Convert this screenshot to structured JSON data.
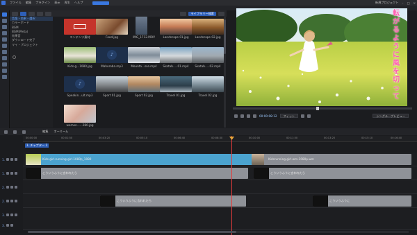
{
  "menu": {
    "items": [
      "ファイル",
      "編集",
      "プラグイン",
      "表示",
      "再生",
      "ヘルプ"
    ],
    "accent": "#3a6fd8"
  },
  "window": {
    "right_text": "新規プロジェクト"
  },
  "library": {
    "categories": [
      "音楽・効果・選択",
      "カラーボード",
      "BGM",
      "BGM(Meta)",
      "効果音",
      "ダウンロード完了",
      "マイ・プロジェクト"
    ],
    "selected_category": 0,
    "tooltip_tab": "ライブラリー検索",
    "items": [
      {
        "label": "コンテンツ素材"
      },
      {
        "label": "Food.jpg"
      },
      {
        "label": "IMG_1712.MOV"
      },
      {
        "label": "Landscape 01.jpg"
      },
      {
        "label": "Landscape 02.jpg"
      },
      {
        "label": "Kids-g...1080.jpg"
      },
      {
        "label": "Mahoroba.mp3"
      },
      {
        "label": "Mounta...sse.mp4"
      },
      {
        "label": "Skatab.....01.mp4"
      },
      {
        "label": "Skatab.....02.mp4"
      },
      {
        "label": "Speakin...ult.mp3"
      },
      {
        "label": "Sport 01.jpg"
      },
      {
        "label": "Sport 02.jpg"
      },
      {
        "label": "Travel 01.jpg"
      },
      {
        "label": "Travel 02.jpg"
      },
      {
        "label": "women......280.jpg"
      }
    ]
  },
  "preview": {
    "overlay_text": [
      "転",
      "が",
      "る",
      "よ",
      "う",
      "に",
      "風",
      "を",
      "切",
      "っ",
      "て"
    ],
    "overlay_color": "#ff5db0",
    "timecode": "00:00:08:12",
    "fit_label": "フィット",
    "quality_label": "シングル...プレビュー"
  },
  "timeline": {
    "toolbar_labels": [
      "編集",
      "オーミーム"
    ],
    "ruler_ticks": [
      "00:00:00",
      "00:01:50",
      "00:03:20",
      "00:05:10",
      "00:06:40",
      "00:08:30",
      "00:10:00",
      "00:11:50",
      "00:13:20",
      "00:15:10",
      "00:16:40",
      "00:18:30"
    ],
    "chapter_label": "1. チャプター 1",
    "tracks": [
      {
        "num": "1.",
        "clips": [
          {
            "label": "Kids-girl-running-girl-1080p_1080"
          },
          {
            "label": "Kidsrunning-girl-wm-1080p.wm"
          }
        ]
      },
      {
        "num": "1.",
        "clips": [
          {
            "label": "こういうふうに言われたら"
          },
          {
            "label": "こういうふうに言われたら"
          }
        ]
      },
      {
        "num": "2.",
        "clips": []
      },
      {
        "num": "2.",
        "clips": [
          {
            "label": "こういうふうに言われたら"
          },
          {
            "label": "こういうふうに"
          }
        ]
      },
      {
        "num": "3.",
        "clips": []
      },
      {
        "num": "3.",
        "clips": []
      }
    ]
  }
}
